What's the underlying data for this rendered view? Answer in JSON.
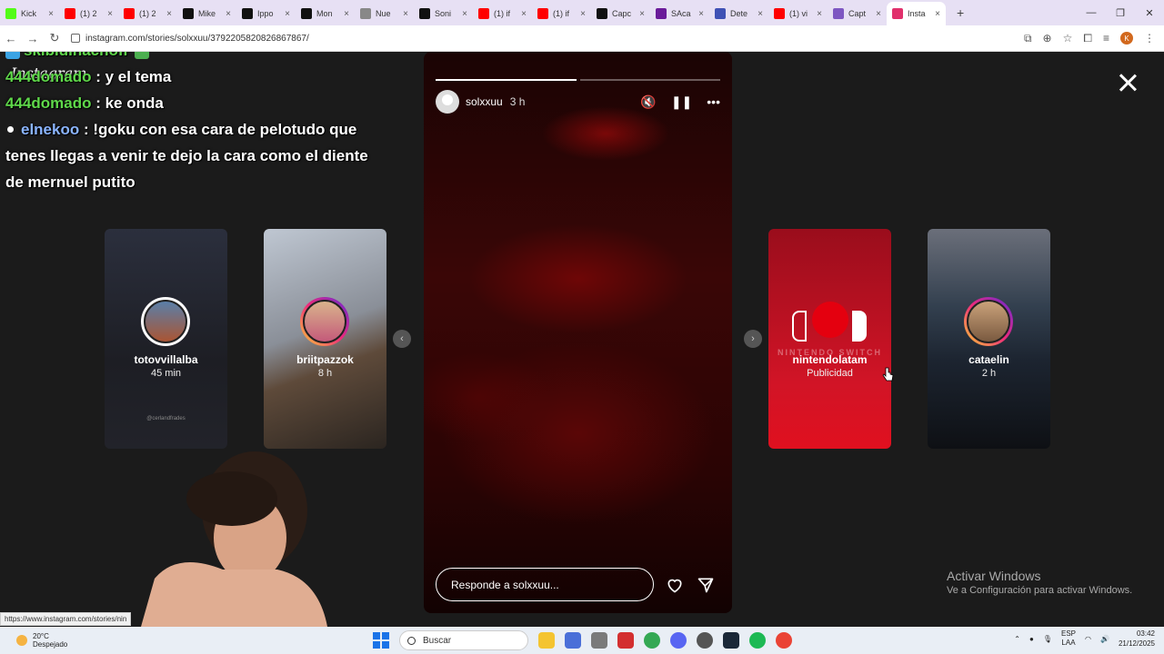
{
  "browser": {
    "tabs": [
      {
        "label": "Kick",
        "color": "#53fc18"
      },
      {
        "label": "(1) 2",
        "color": "#ff0000"
      },
      {
        "label": "(1) 2",
        "color": "#ff0000"
      },
      {
        "label": "Mike",
        "color": "#111111"
      },
      {
        "label": "Ippo",
        "color": "#111111"
      },
      {
        "label": "Mon",
        "color": "#111111"
      },
      {
        "label": "Nue",
        "color": "#888888"
      },
      {
        "label": "Soni",
        "color": "#111111"
      },
      {
        "label": "(1) if",
        "color": "#ff0000"
      },
      {
        "label": "(1) if",
        "color": "#ff0000"
      },
      {
        "label": "Capc",
        "color": "#111111"
      },
      {
        "label": "SAca",
        "color": "#6a1b9a"
      },
      {
        "label": "Dete",
        "color": "#3f51b5"
      },
      {
        "label": "(1) vi",
        "color": "#ff0000"
      },
      {
        "label": "Capt",
        "color": "#7e57c2"
      },
      {
        "label": "Insta",
        "color": "#e1306c"
      }
    ],
    "url": "instagram.com/stories/solxxuu/3792205820826867867/"
  },
  "chat": {
    "lines": [
      {
        "user": "skibidinachofr",
        "text": ""
      },
      {
        "user": "444domado",
        "text": ": y el tema"
      },
      {
        "user": "444domado",
        "text": ": ke onda"
      },
      {
        "user": "elnekoo",
        "text": ": !goku con esa cara de pelotudo que tenes llegas a venir te dejo la cara como el diente de mernuel putito"
      }
    ]
  },
  "instagram": {
    "logo": "Instagram"
  },
  "story": {
    "user": "solxxuu",
    "time": "3 h",
    "progress": [
      1.0,
      0.0
    ],
    "reply_placeholder": "Responde a solxxuu..."
  },
  "side_stories": [
    {
      "name": "totovvillalba",
      "time": "45 min",
      "tag": "@cerlandfrades"
    },
    {
      "name": "briitpazzok",
      "time": "8 h"
    },
    {
      "name": "nintendolatam",
      "time": "Publicidad",
      "brand": "NINTENDO SWITCH"
    },
    {
      "name": "cataelin",
      "time": "2 h"
    }
  ],
  "windows_notice": {
    "title": "Activar Windows",
    "subtitle": "Ve a Configuración para activar Windows."
  },
  "status_url": "https://www.instagram.com/stories/nin",
  "taskbar": {
    "temp": "20°C",
    "weather": "Despejado",
    "search": "Buscar",
    "lang1": "ESP",
    "lang2": "LAA",
    "time": "03:42",
    "date": "21/12/2025"
  }
}
